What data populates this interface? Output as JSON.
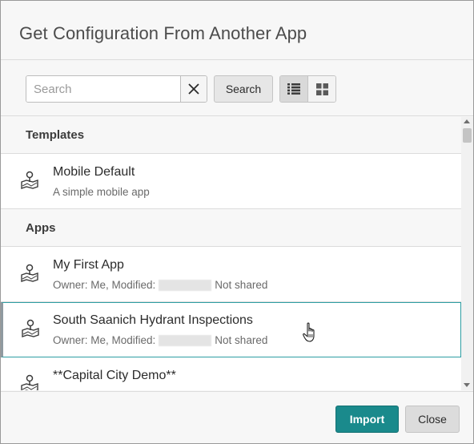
{
  "dialog": {
    "title": "Get Configuration From Another App"
  },
  "toolbar": {
    "search_placeholder": "Search",
    "search_value": "",
    "search_label": "Search",
    "clear_icon": "close-icon",
    "list_view_icon": "list-icon",
    "grid_view_icon": "grid-icon",
    "active_view": "list"
  },
  "templates": {
    "header": "Templates",
    "items": [
      {
        "title": "Mobile Default",
        "subtitle": "A simple mobile app",
        "icon": "map-pin-icon"
      }
    ]
  },
  "apps": {
    "header": "Apps",
    "items": [
      {
        "title": "My First App",
        "owner_text": "Owner: Me, Modified:",
        "shared": "Not shared",
        "icon": "map-pin-icon"
      },
      {
        "title": "South Saanich Hydrant Inspections",
        "owner_text": "Owner: Me, Modified:",
        "shared": "Not shared",
        "icon": "map-pin-icon",
        "hovered": true
      },
      {
        "title": "**Capital City Demo**",
        "icon": "map-pin-icon"
      }
    ]
  },
  "footer": {
    "import_label": "Import",
    "close_label": "Close"
  },
  "colors": {
    "accent": "#1a8a8c",
    "hover_border": "#2e9ea3"
  }
}
